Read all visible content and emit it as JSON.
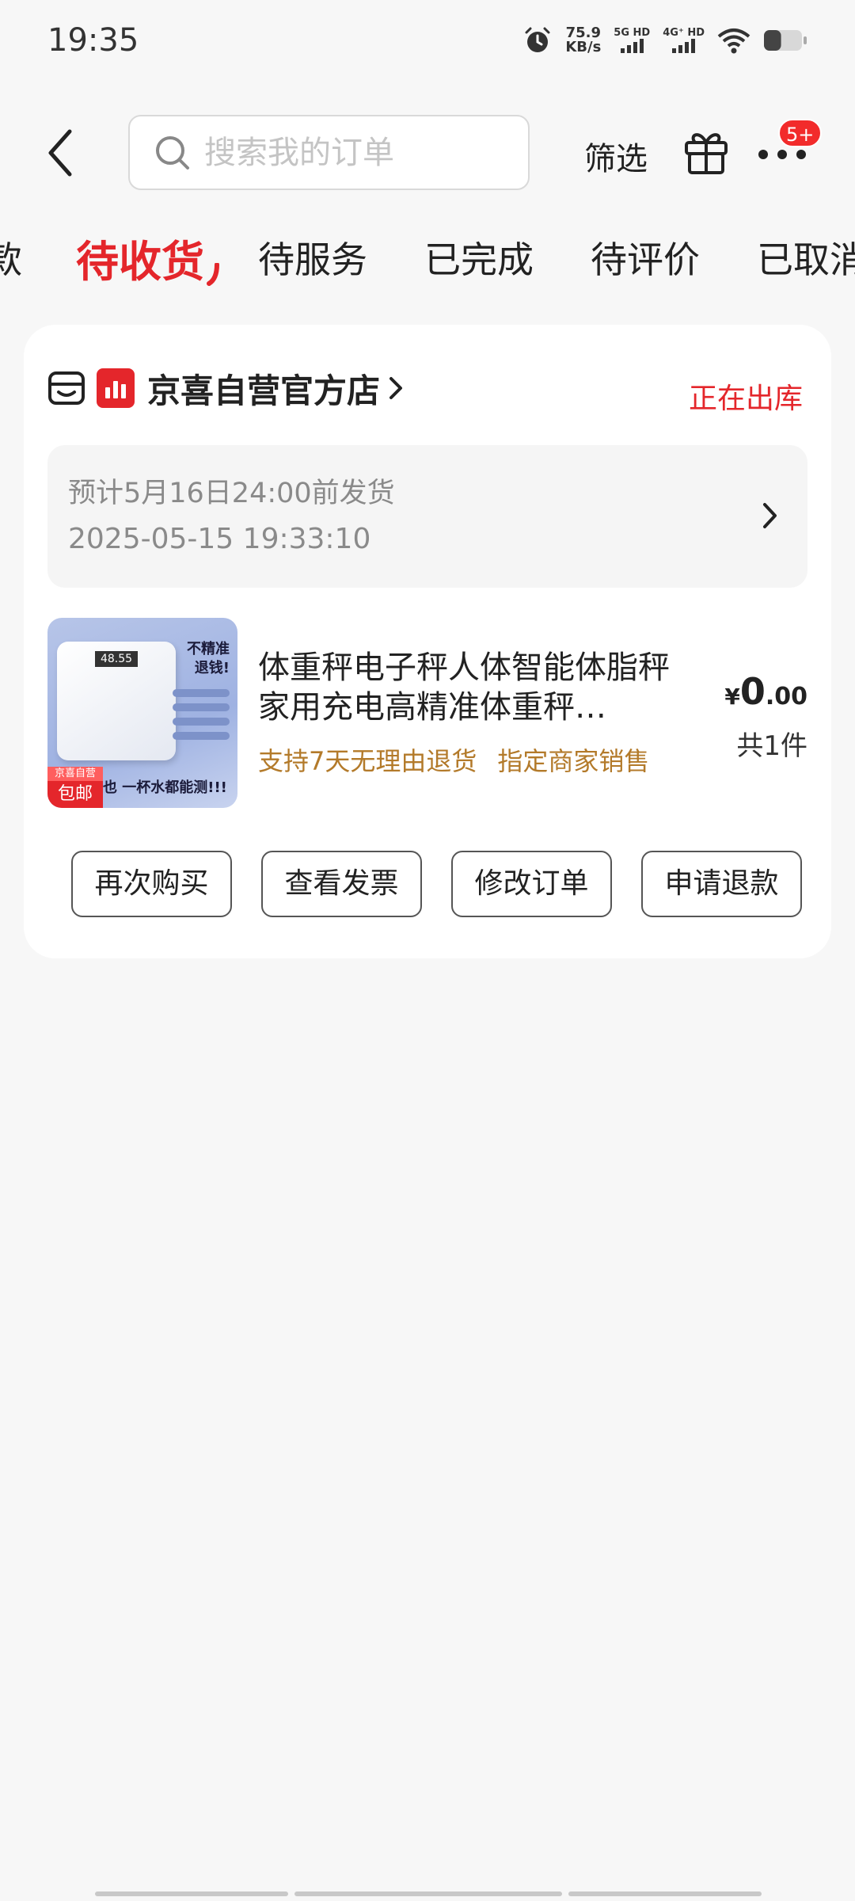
{
  "status_bar": {
    "time": "19:35",
    "net_speed_value": "75.9",
    "net_speed_unit": "KB/s",
    "sim1_label": "5G HD",
    "sim2_label": "4G⁺ HD",
    "battery_level": 0.45
  },
  "header": {
    "search_placeholder": "搜索我的订单",
    "filter_label": "筛选",
    "more_badge": "5+"
  },
  "tabs": [
    {
      "label": "款",
      "active": false
    },
    {
      "label": "待收货",
      "active": true
    },
    {
      "label": "待服务",
      "active": false
    },
    {
      "label": "已完成",
      "active": false
    },
    {
      "label": "待评价",
      "active": false
    },
    {
      "label": "已取消",
      "active": false
    }
  ],
  "order": {
    "shop_name": "京喜自营官方店",
    "status": "正在出库",
    "ship_estimate": "预计5月16日24:00前发货",
    "ship_time": "2025-05-15 19:33:10",
    "product": {
      "title": "体重秤电子秤人体智能体脂秤家用充电高精准体重秤…",
      "tags": [
        "支持7天无理由退货",
        "指定商家销售"
      ],
      "price_symbol": "¥",
      "price_int": "0",
      "price_dec": ".00",
      "quantity": "共1件",
      "image": {
        "promo_line1": "不精准",
        "promo_line2": "退钱!",
        "badge_top": "京喜自营",
        "badge_bottom": "包邮",
        "bottom_text": "也 一杯水都能测!!!",
        "display_text": "48.55"
      }
    },
    "actions": [
      "再次购买",
      "查看发票",
      "修改订单",
      "申请退款"
    ]
  },
  "colors": {
    "accent_red": "#e4262b",
    "tag_gold": "#b37a2a",
    "background": "#f7f7f7"
  }
}
